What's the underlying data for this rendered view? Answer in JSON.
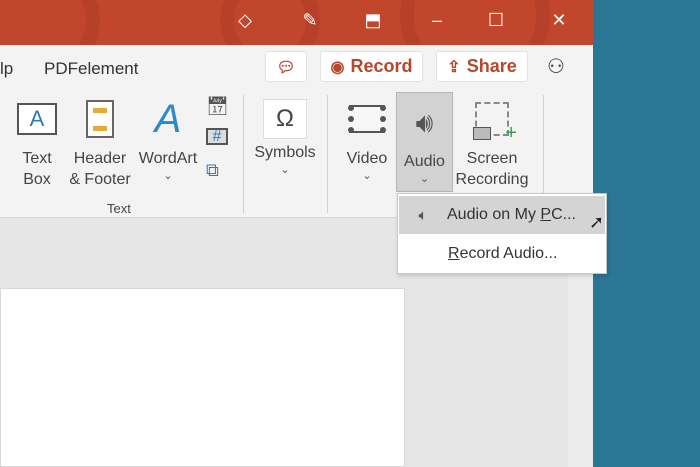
{
  "titlebar": {
    "icons": [
      "diamond-icon",
      "magic-wand-icon",
      "restore-ribbon-icon",
      "minimize-icon",
      "maximize-icon",
      "close-icon"
    ]
  },
  "tabs": {
    "partial": "lp",
    "pdfelement": "PDFelement"
  },
  "actions": {
    "record": "Record",
    "share": "Share"
  },
  "ribbon": {
    "text_box": [
      "Text",
      "Box"
    ],
    "header_footer": [
      "Header",
      "& Footer"
    ],
    "wordart": "WordArt",
    "text_group": "Text",
    "symbols": "Symbols",
    "video": "Video",
    "audio": "Audio",
    "screen_recording": [
      "Screen",
      "Recording"
    ]
  },
  "menu": {
    "audio_on_pc_pre": "Audio on My ",
    "audio_on_pc_key": "P",
    "audio_on_pc_post": "C...",
    "record_audio_key": "R",
    "record_audio_post": "ecord Audio..."
  },
  "colors": {
    "titlebar": "#c2462b",
    "desktop": "#2a7694",
    "accent": "#b7472a"
  }
}
